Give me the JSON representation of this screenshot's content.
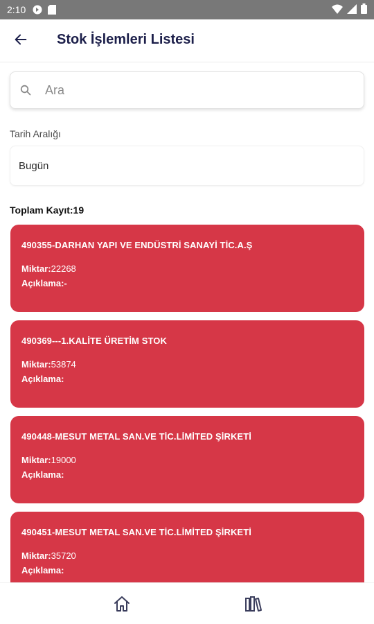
{
  "statusbar": {
    "time": "2:10"
  },
  "header": {
    "title": "Stok İşlemleri Listesi"
  },
  "search": {
    "placeholder": "Ara"
  },
  "date_range": {
    "label": "Tarih Aralığı",
    "value": "Bugün"
  },
  "summary": {
    "total_text": "Toplam Kayıt:19"
  },
  "labels": {
    "miktar": "Miktar:",
    "aciklama": "Açıklama:"
  },
  "records": [
    {
      "name": "490355-DARHAN YAPI VE ENDÜSTRİ SANAYİ TİC.A.Ş",
      "miktar": "22268",
      "aciklama": "-"
    },
    {
      "name": "490369---1.KALİTE ÜRETİM STOK",
      "miktar": "53874",
      "aciklama": ""
    },
    {
      "name": "490448-MESUT METAL SAN.VE TİC.LİMİTED ŞİRKETİ",
      "miktar": "19000",
      "aciklama": ""
    },
    {
      "name": "490451-MESUT METAL SAN.VE TİC.LİMİTED ŞİRKETİ",
      "miktar": "35720",
      "aciklama": ""
    }
  ],
  "colors": {
    "card": "#d63747",
    "title": "#1c1f4a",
    "statusbar": "#787878"
  },
  "icons": {
    "back": "arrow-left-icon",
    "search": "search-icon",
    "home": "home-icon",
    "stats": "library-icon"
  }
}
